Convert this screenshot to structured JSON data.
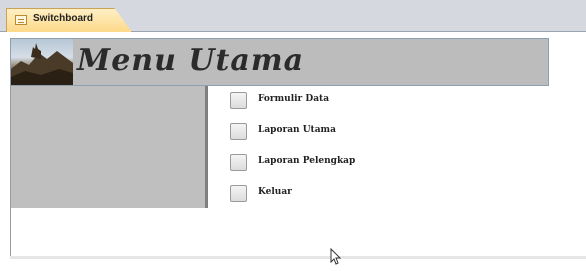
{
  "document_tab": {
    "label": "Switchboard",
    "icon": "form-icon"
  },
  "header": {
    "title": "Menu Utama",
    "logo": "landscape-image"
  },
  "menu": {
    "items": [
      {
        "label": "Formulir Data"
      },
      {
        "label": "Laporan Utama"
      },
      {
        "label": "Laporan Pelengkap"
      },
      {
        "label": "Keluar"
      }
    ]
  },
  "colors": {
    "tab_fill": "#fcd98a",
    "header_fill": "#bcbcbc",
    "left_panel_fill": "#bfbfbf"
  }
}
